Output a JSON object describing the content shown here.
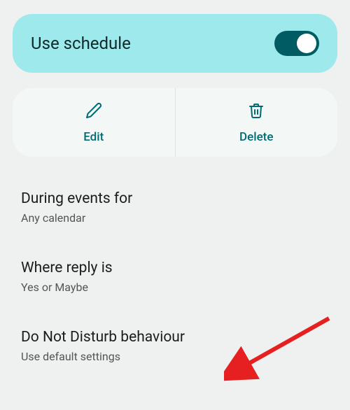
{
  "toggle": {
    "label": "Use schedule",
    "enabled": true
  },
  "actions": {
    "edit": {
      "label": "Edit",
      "icon": "pencil-icon"
    },
    "delete": {
      "label": "Delete",
      "icon": "trash-icon"
    }
  },
  "settings": [
    {
      "title": "During events for",
      "subtitle": "Any calendar"
    },
    {
      "title": "Where reply is",
      "subtitle": "Yes or Maybe"
    },
    {
      "title": "Do Not Disturb behaviour",
      "subtitle": "Use default settings"
    }
  ],
  "annotation": {
    "type": "arrow",
    "color": "#e62020"
  }
}
